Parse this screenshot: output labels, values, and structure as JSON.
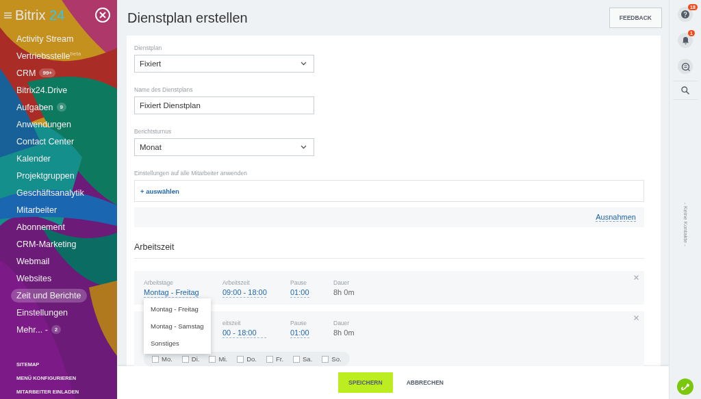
{
  "sidebar": {
    "logo": {
      "name": "Bitrix",
      "suffix": "24"
    },
    "items": [
      {
        "label": "Activity Stream",
        "selected": false
      },
      {
        "label": "Vertriebsstelle$^{beta}$",
        "selected": false
      },
      {
        "label": "CRM",
        "badge": "99+",
        "selected": false
      },
      {
        "label": "Bitrix24.Drive",
        "selected": false
      },
      {
        "label": "Aufgaben",
        "badge": "9",
        "selected": false
      },
      {
        "label": "Anwendungen",
        "selected": false
      },
      {
        "label": "Contact Center",
        "selected": false
      },
      {
        "label": "Kalender",
        "selected": false
      },
      {
        "label": "Projektgruppen",
        "selected": false
      },
      {
        "label": "Geschäftsanalytik",
        "selected": false
      },
      {
        "label": "Mitarbeiter",
        "selected": false
      },
      {
        "label": "Abonnement",
        "selected": false
      },
      {
        "label": "CRM-Marketing",
        "selected": false
      },
      {
        "label": "Webmail",
        "selected": false
      },
      {
        "label": "Websites",
        "selected": false
      },
      {
        "label": "Zeit und Berichte",
        "selected": true
      },
      {
        "label": "Einstellungen",
        "selected": false
      },
      {
        "label": "Mehr... -",
        "badge": "2",
        "selected": false
      }
    ],
    "footer_links": [
      "SITEMAP",
      "MENÜ KONFIGURIEREN",
      "MITARBEITER EINLADEN"
    ]
  },
  "header": {
    "title": "Dienstplan erstellen",
    "feedback_button": "FEEDBACK"
  },
  "form": {
    "fields": [
      {
        "label": "Dienstplan",
        "kind": "select",
        "value": "Fixiert"
      },
      {
        "label": "Name des Dienstplans",
        "kind": "text",
        "value": "Fixiert Dienstplan"
      },
      {
        "label": "Berichtsturnus",
        "kind": "select",
        "value": "Monat"
      }
    ],
    "apply": {
      "label": "Einstellungen auf alle Mitarbeiter anwenden",
      "link": "+ auswählen"
    },
    "exceptions_link": "Ausnahmen"
  },
  "work_time": {
    "heading": "Arbeitszeit",
    "rows": [
      {
        "cells": [
          {
            "label": "Arbeitstage",
            "value": "Montag - Freitag",
            "kind": "link"
          },
          {
            "label": "Arbeitszeit",
            "value": "09:00 - 18:00",
            "kind": "link"
          },
          {
            "label": "Pause",
            "value": "01:00",
            "kind": "link"
          },
          {
            "label": "Dauer",
            "value": "8h 0m",
            "kind": "text"
          }
        ]
      },
      {
        "time": {
          "label": "eitszeit",
          "value": "00 - 18:00"
        },
        "break": {
          "label": "Pause",
          "value": "01:00"
        },
        "duration": {
          "label": "Dauer",
          "value": "8h 0m"
        },
        "days": [
          {
            "label": "Mo.",
            "checked": false
          },
          {
            "label": "Di.",
            "checked": false
          },
          {
            "label": "Mi.",
            "checked": false
          },
          {
            "label": "Do.",
            "checked": false
          },
          {
            "label": "Fr.",
            "checked": false
          },
          {
            "label": "Sa.",
            "checked": false
          },
          {
            "label": "So.",
            "checked": false
          }
        ]
      }
    ],
    "dropdown": [
      "Montag - Freitag",
      "Montag - Samstag",
      "Sonstiges"
    ]
  },
  "footer": {
    "save": "SPEICHERN",
    "cancel": "ABBRECHEN"
  },
  "right_panel": {
    "help_badge": "18",
    "notifications_badge": "1",
    "contacts_text": "- Keine Kontakte -"
  }
}
